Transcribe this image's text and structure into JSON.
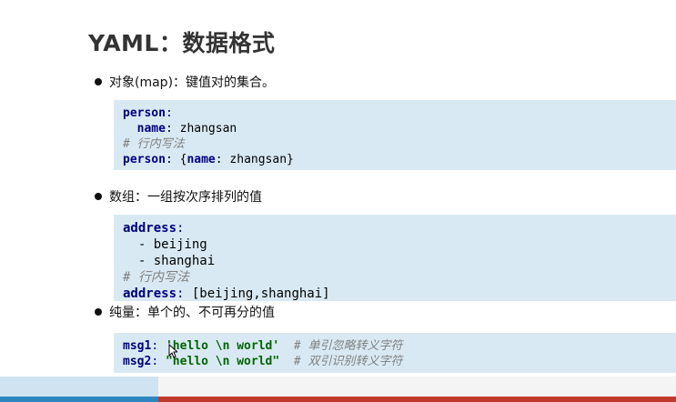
{
  "title": "YAML：数据格式",
  "sections": [
    {
      "bullet": "对象(map)：键值对的集合。",
      "code": [
        [
          {
            "t": "person",
            "c": "k"
          },
          {
            "t": ":",
            "c": "p"
          }
        ],
        [
          {
            "t": "  name",
            "c": "k"
          },
          {
            "t": ": zhangsan",
            "c": "v"
          }
        ],
        [
          {
            "t": "# 行内写法",
            "c": "c"
          }
        ],
        [
          {
            "t": "person",
            "c": "k"
          },
          {
            "t": ": {",
            "c": "v"
          },
          {
            "t": "name",
            "c": "k"
          },
          {
            "t": ": zhangsan}",
            "c": "v"
          }
        ]
      ]
    },
    {
      "bullet": "数组：一组按次序排列的值",
      "code": [
        [
          {
            "t": "address",
            "c": "k"
          },
          {
            "t": ":",
            "c": "p"
          }
        ],
        [
          {
            "t": "  - beijing",
            "c": "v"
          }
        ],
        [
          {
            "t": "  - shanghai",
            "c": "v"
          }
        ],
        [
          {
            "t": "# 行内写法",
            "c": "c"
          }
        ],
        [
          {
            "t": "address",
            "c": "k"
          },
          {
            "t": ": ",
            "c": "p"
          },
          {
            "t": "[beijing,shanghai]",
            "c": "v"
          }
        ]
      ]
    },
    {
      "bullet": "纯量：单个的、不可再分的值",
      "code": [
        [
          {
            "t": "msg1",
            "c": "k"
          },
          {
            "t": ": ",
            "c": "p"
          },
          {
            "t": "'hello \\n world'",
            "c": "s"
          },
          {
            "t": "  # 单引忽略转义字符",
            "c": "c"
          }
        ],
        [
          {
            "t": "msg2",
            "c": "k"
          },
          {
            "t": ": ",
            "c": "p"
          },
          {
            "t": "\"hello \\n world\"",
            "c": "s"
          },
          {
            "t": "  # 双引识别转义字符",
            "c": "c"
          }
        ]
      ]
    }
  ],
  "colors": {
    "code_bg": "#d9e9f3",
    "key": "#000080",
    "string": "#006400",
    "comment": "#808080",
    "progress_played": "#2e86c1",
    "progress_bar": "#c0392b"
  },
  "icons": [
    "mouse-cursor-icon"
  ]
}
